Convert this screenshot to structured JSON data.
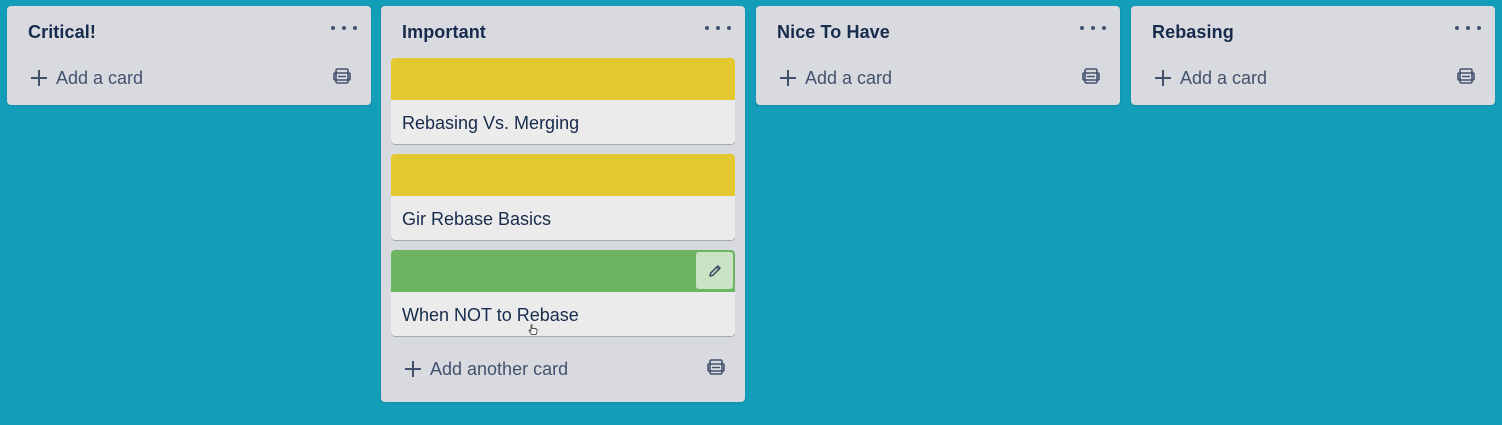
{
  "colors": {
    "board_background": "#139db9",
    "list_background": "#d9dadf",
    "card_background": "#ebebeb",
    "cover_yellow": "#e3c92f",
    "cover_green": "#6db563"
  },
  "lists": [
    {
      "title": "Critical!",
      "add_label": "Add a card"
    },
    {
      "title": "Important",
      "cards": [
        {
          "title": "Rebasing Vs. Merging",
          "cover": "#e3c92f"
        },
        {
          "title": "Gir Rebase Basics",
          "cover": "#e3c92f"
        },
        {
          "title": "When NOT to Rebase",
          "cover": "#6db563"
        }
      ],
      "add_label": "Add another card"
    },
    {
      "title": "Nice To Have",
      "add_label": "Add a card"
    },
    {
      "title": "Rebasing",
      "add_label": "Add a card"
    }
  ],
  "icons": {
    "list_menu": "more-horizontal-icon",
    "add": "plus-icon",
    "template": "card-template-icon",
    "edit": "pencil-icon",
    "cursor": "hand-pointer-icon"
  }
}
